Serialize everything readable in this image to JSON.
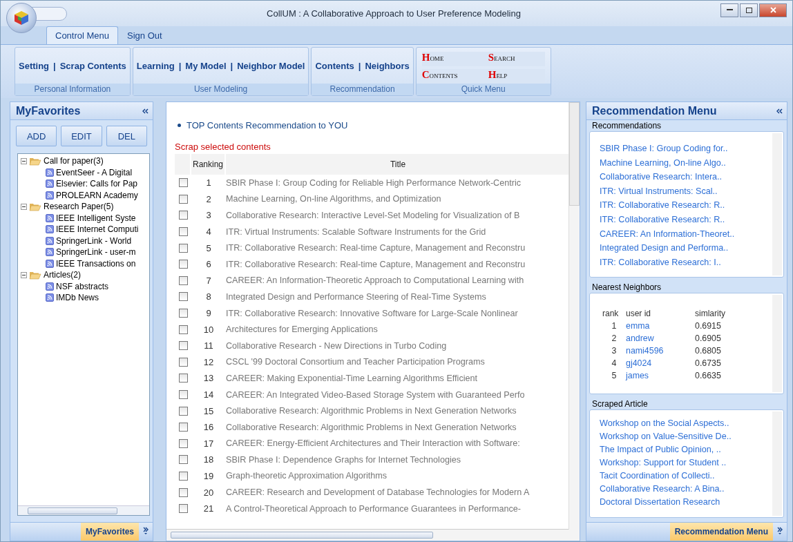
{
  "window": {
    "title": "CollUM : A Collaborative Approach to User Preference Modeling"
  },
  "menu_tabs": [
    {
      "label": "Control Menu",
      "selected": true
    },
    {
      "label": "Sign Out",
      "selected": false
    }
  ],
  "ribbon": {
    "groups": [
      {
        "label": "Personal Information",
        "separator": "|",
        "items": [
          "Setting",
          "Scrap Contents"
        ]
      },
      {
        "label": "User Modeling",
        "separator": "|",
        "items": [
          "Learning",
          "My Model",
          "Neighbor Model"
        ]
      },
      {
        "label": "Recommendation",
        "separator": "|",
        "items": [
          "Contents",
          "Neighbors"
        ]
      }
    ],
    "quick_menu": {
      "label": "Quick Menu",
      "items": [
        "Home",
        "Search",
        "Contents",
        "Help"
      ]
    }
  },
  "left_panel": {
    "title": "MyFavorites",
    "buttons": [
      "ADD",
      "EDIT",
      "DEL"
    ],
    "tree": [
      {
        "label": "Call for paper(3)",
        "expanded": true,
        "children": [
          {
            "label": "EventSeer - A Digital"
          },
          {
            "label": "Elsevier: Calls for Pap"
          },
          {
            "label": "PROLEARN Academy"
          }
        ]
      },
      {
        "label": "Research Paper(5)",
        "expanded": true,
        "children": [
          {
            "label": "IEEE Intelligent Syste"
          },
          {
            "label": "IEEE Internet Computi"
          },
          {
            "label": "SpringerLink - World"
          },
          {
            "label": "SpringerLink - user-m"
          },
          {
            "label": "IEEE Transactions on"
          }
        ]
      },
      {
        "label": "Articles(2)",
        "expanded": true,
        "children": [
          {
            "label": "NSF abstracts"
          },
          {
            "label": "IMDb News"
          }
        ]
      }
    ],
    "footer_tab": "MyFavorites"
  },
  "content": {
    "heading": "TOP Contents Recommendation to YOU",
    "scrap_link": "Scrap selected contents",
    "columns": [
      "Ranking",
      "Title"
    ],
    "rows": [
      {
        "checked": false,
        "rank": "1",
        "title": "SBIR Phase I: Group Coding for Reliable High Performance Network-Centric"
      },
      {
        "checked": false,
        "rank": "2",
        "title": "Machine Learning, On-line Algorithms, and Optimization"
      },
      {
        "checked": false,
        "rank": "3",
        "title": "Collaborative Research: Interactive Level-Set Modeling for Visualization of B"
      },
      {
        "checked": false,
        "rank": "4",
        "title": "ITR: Virtual Instruments: Scalable Software Instruments for the Grid"
      },
      {
        "checked": false,
        "rank": "5",
        "title": "ITR: Collaborative Research: Real-time Capture, Management and Reconstru"
      },
      {
        "checked": false,
        "rank": "6",
        "title": "ITR: Collaborative Research: Real-time Capture, Management and Reconstru"
      },
      {
        "checked": false,
        "rank": "7",
        "title": "CAREER: An Information-Theoretic Approach to Computational Learning with"
      },
      {
        "checked": false,
        "rank": "8",
        "title": "Integrated Design and Performance Steering of Real-Time Systems"
      },
      {
        "checked": false,
        "rank": "9",
        "title": "ITR: Collaborative Research: Innovative Software for Large-Scale Nonlinear"
      },
      {
        "checked": false,
        "rank": "10",
        "title": "Architectures for Emerging Applications"
      },
      {
        "checked": false,
        "rank": "11",
        "title": "Collaborative Research - New Directions in Turbo Coding"
      },
      {
        "checked": false,
        "rank": "12",
        "title": "CSCL '99 Doctoral Consortium and Teacher Participation Programs"
      },
      {
        "checked": false,
        "rank": "13",
        "title": "CAREER: Making Exponential-Time Learning Algorithms Efficient"
      },
      {
        "checked": false,
        "rank": "14",
        "title": "CAREER: An Integrated Video-Based Storage System with Guaranteed Perfo"
      },
      {
        "checked": false,
        "rank": "15",
        "title": "Collaborative Research: Algorithmic Problems in Next Generation Networks"
      },
      {
        "checked": false,
        "rank": "16",
        "title": "Collaborative Research: Algorithmic Problems in Next Generation Networks"
      },
      {
        "checked": false,
        "rank": "17",
        "title": "CAREER: Energy-Efficient Architectures and Their Interaction with Software:"
      },
      {
        "checked": false,
        "rank": "18",
        "title": "SBIR Phase I: Dependence Graphs for Internet Technologies"
      },
      {
        "checked": false,
        "rank": "19",
        "title": "Graph-theoretic Approximation Algorithms"
      },
      {
        "checked": false,
        "rank": "20",
        "title": "CAREER: Research and Development of Database Technologies for Modern A"
      },
      {
        "checked": false,
        "rank": "21",
        "title": "A Control-Theoretical Approach to Performance Guarantees in Performance-"
      }
    ]
  },
  "right_panel": {
    "title": "Recommendation Menu",
    "recommendations": {
      "label": "Recommendations",
      "items": [
        "SBIR Phase I: Group Coding for..",
        "Machine Learning, On-line Algo..",
        "Collaborative Research: Intera..",
        "ITR: Virtual Instruments: Scal..",
        "ITR: Collaborative Research: R..",
        "ITR: Collaborative Research: R..",
        "CAREER: An Information-Theoret..",
        "Integrated Design and Performa..",
        "ITR: Collaborative Research: I.."
      ]
    },
    "neighbors": {
      "label": "Nearest Neighbors",
      "columns": [
        "rank",
        "user id",
        "simlarity"
      ],
      "rows": [
        {
          "rank": "1",
          "user_id": "emma",
          "similarity": "0.6915"
        },
        {
          "rank": "2",
          "user_id": "andrew",
          "similarity": "0.6905"
        },
        {
          "rank": "3",
          "user_id": "nami4596",
          "similarity": "0.6805"
        },
        {
          "rank": "4",
          "user_id": "gj4024",
          "similarity": "0.6735"
        },
        {
          "rank": "5",
          "user_id": "james",
          "similarity": "0.6635"
        }
      ]
    },
    "scraped": {
      "label": "Scraped Article",
      "items": [
        "Workshop on the Social Aspects..",
        "Workshop on Value-Sensitive De..",
        "The Impact of Public Opinion, ..",
        "Workshop: Support for Student ..",
        "Tacit Coordination of Collecti..",
        "Collaborative Research: A Bina..",
        "Doctoral Dissertation Research"
      ]
    },
    "footer_tab": "Recommendation Menu"
  }
}
